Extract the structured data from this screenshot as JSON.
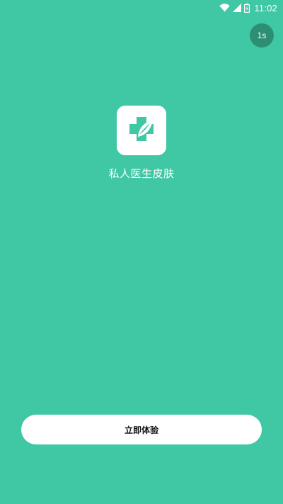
{
  "status_bar": {
    "time": "11:02",
    "icons": [
      "wifi-icon",
      "cellular-signal-icon",
      "battery-icon"
    ]
  },
  "splash": {
    "countdown_label": "1s",
    "app_name": "私人医生皮肤",
    "logo_icon": "medical-cross-leaf-icon",
    "cta_label": "立即体验"
  },
  "colors": {
    "background": "#40c7a4",
    "badge": "#2c8f73",
    "logo_tile": "#ffffff",
    "button": "#ffffff",
    "button_text": "#111111",
    "text": "#ffffff"
  }
}
